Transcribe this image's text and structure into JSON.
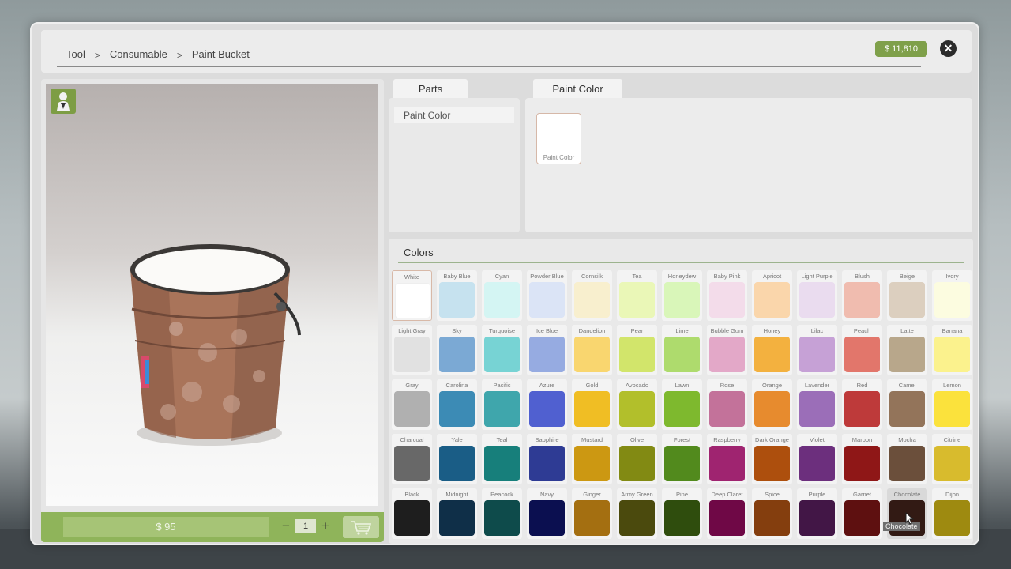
{
  "breadcrumb": [
    {
      "label": "Tool"
    },
    {
      "label": "Consumable"
    },
    {
      "label": "Paint Bucket"
    }
  ],
  "breadcrumb_separator": ">",
  "money": "$ 11,810",
  "close_symbol": "✕",
  "price": "$ 95",
  "quantity": "1",
  "qty_minus": "−",
  "qty_plus": "+",
  "tabs": {
    "parts": "Parts",
    "paint_color": "Paint Color"
  },
  "parts_list": [
    {
      "label": "Paint Color"
    }
  ],
  "paint_slot": {
    "label": "Paint Color",
    "color": "#ffffff"
  },
  "colors_title": "Colors",
  "selected_color": "White",
  "hovered_color": "Chocolate",
  "tooltip": "Chocolate",
  "swatches": [
    [
      {
        "name": "White",
        "color": "#ffffff"
      },
      {
        "name": "Baby Blue",
        "color": "#c6e2ef"
      },
      {
        "name": "Cyan",
        "color": "#d4f5f3"
      },
      {
        "name": "Powder Blue",
        "color": "#dbe4f6"
      },
      {
        "name": "Cornsilk",
        "color": "#f8efce"
      },
      {
        "name": "Tea",
        "color": "#eaf7b7"
      },
      {
        "name": "Honeydew",
        "color": "#d9f6b9"
      },
      {
        "name": "Baby Pink",
        "color": "#f3dcea"
      },
      {
        "name": "Apricot",
        "color": "#fad6ab"
      },
      {
        "name": "Light Purple",
        "color": "#eadcef"
      },
      {
        "name": "Blush",
        "color": "#f0bcaf"
      },
      {
        "name": "Beige",
        "color": "#dccfbf"
      },
      {
        "name": "Ivory",
        "color": "#fcfce0"
      }
    ],
    [
      {
        "name": "Light Gray",
        "color": "#e1e1e1"
      },
      {
        "name": "Sky",
        "color": "#7ba9d4"
      },
      {
        "name": "Turquoise",
        "color": "#77d3d4"
      },
      {
        "name": "Ice Blue",
        "color": "#96abe1"
      },
      {
        "name": "Dandelion",
        "color": "#f9d66f"
      },
      {
        "name": "Pear",
        "color": "#d2e56b"
      },
      {
        "name": "Lime",
        "color": "#aedb6d"
      },
      {
        "name": "Bubble Gum",
        "color": "#e3a8c8"
      },
      {
        "name": "Honey",
        "color": "#f3b13f"
      },
      {
        "name": "Lilac",
        "color": "#c6a1d6"
      },
      {
        "name": "Peach",
        "color": "#e2766b"
      },
      {
        "name": "Latte",
        "color": "#b8a78b"
      },
      {
        "name": "Banana",
        "color": "#fbf28d"
      }
    ],
    [
      {
        "name": "Gray",
        "color": "#b0b0b0"
      },
      {
        "name": "Carolina",
        "color": "#3c8bb5"
      },
      {
        "name": "Pacific",
        "color": "#3fa6ac"
      },
      {
        "name": "Azure",
        "color": "#5060d0"
      },
      {
        "name": "Gold",
        "color": "#f0be24"
      },
      {
        "name": "Avocado",
        "color": "#b2bf2b"
      },
      {
        "name": "Lawn",
        "color": "#7eb92e"
      },
      {
        "name": "Rose",
        "color": "#c3729a"
      },
      {
        "name": "Orange",
        "color": "#e78b2e"
      },
      {
        "name": "Lavender",
        "color": "#9b6eb8"
      },
      {
        "name": "Red",
        "color": "#be3a3a"
      },
      {
        "name": "Camel",
        "color": "#93745a"
      },
      {
        "name": "Lemon",
        "color": "#fbe23c"
      }
    ],
    [
      {
        "name": "Charcoal",
        "color": "#686868"
      },
      {
        "name": "Yale",
        "color": "#1a5d86"
      },
      {
        "name": "Teal",
        "color": "#177f7b"
      },
      {
        "name": "Sapphire",
        "color": "#2e3b94"
      },
      {
        "name": "Mustard",
        "color": "#cc9812"
      },
      {
        "name": "Olive",
        "color": "#828a13"
      },
      {
        "name": "Forest",
        "color": "#528a1d"
      },
      {
        "name": "Raspberry",
        "color": "#9f2470"
      },
      {
        "name": "Dark Orange",
        "color": "#ad4f0d"
      },
      {
        "name": "Violet",
        "color": "#6c2f7d"
      },
      {
        "name": "Maroon",
        "color": "#8f1717"
      },
      {
        "name": "Mocha",
        "color": "#6b4f3b"
      },
      {
        "name": "Citrine",
        "color": "#d8bb2d"
      }
    ],
    [
      {
        "name": "Black",
        "color": "#1e1e1e"
      },
      {
        "name": "Midnight",
        "color": "#0f2f48"
      },
      {
        "name": "Peacock",
        "color": "#0e4b4b"
      },
      {
        "name": "Navy",
        "color": "#0b0f50"
      },
      {
        "name": "Ginger",
        "color": "#a46f11"
      },
      {
        "name": "Army Green",
        "color": "#4b4a0d"
      },
      {
        "name": "Pine",
        "color": "#2f4d0d"
      },
      {
        "name": "Deep Claret",
        "color": "#6f0846"
      },
      {
        "name": "Spice",
        "color": "#843e0e"
      },
      {
        "name": "Purple",
        "color": "#421646"
      },
      {
        "name": "Garnet",
        "color": "#5e1010"
      },
      {
        "name": "Chocolate",
        "color": "#321a14"
      },
      {
        "name": "Dijon",
        "color": "#9e8a10"
      }
    ]
  ],
  "accent_color": "#7fa04a"
}
